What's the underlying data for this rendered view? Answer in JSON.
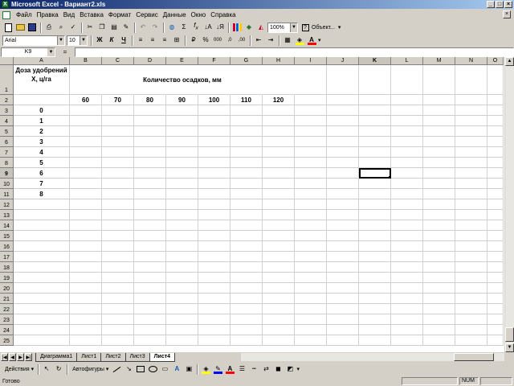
{
  "window": {
    "title": "Microsoft Excel - Вариант2.xls",
    "minimize": "_",
    "maximize": "□",
    "close": "×"
  },
  "menu": [
    "Файл",
    "Правка",
    "Вид",
    "Вставка",
    "Формат",
    "Сервис",
    "Данные",
    "Окно",
    "Справка"
  ],
  "toolbar_std": {
    "zoom": "100%",
    "objects_label": "Объект..."
  },
  "toolbar_fmt": {
    "font": "Arial",
    "size": "10",
    "bold": "Ж",
    "italic": "К",
    "underline": "Ч",
    "percent": "%",
    "thousands": "000"
  },
  "formula_bar": {
    "name_box": "K9",
    "equals": "=",
    "value": ""
  },
  "columns": [
    "A",
    "B",
    "C",
    "D",
    "E",
    "F",
    "G",
    "H",
    "I",
    "J",
    "K",
    "L",
    "M",
    "N",
    "O"
  ],
  "active_column": "K",
  "active_row": "9",
  "rows": [
    "1",
    "2",
    "3",
    "4",
    "5",
    "6",
    "7",
    "8",
    "9",
    "10",
    "11",
    "12",
    "13",
    "14",
    "15",
    "16",
    "17",
    "18",
    "19",
    "20",
    "21",
    "22",
    "23",
    "24",
    "25"
  ],
  "cells": {
    "a1": "Доза удобрений X, ц/га",
    "b1": "Количество осадков, мм",
    "row2": [
      "",
      "60",
      "70",
      "80",
      "90",
      "100",
      "110",
      "120",
      "",
      "",
      "",
      "",
      "",
      "",
      ""
    ],
    "col_a": [
      "0",
      "1",
      "2",
      "3",
      "4",
      "5",
      "6",
      "7",
      "8"
    ]
  },
  "sheet_tabs": [
    "Диаграмма1",
    "Лист1",
    "Лист2",
    "Лист3",
    "Лист4"
  ],
  "active_tab": "Лист4",
  "draw_toolbar": {
    "actions": "Действия",
    "autoshapes": "Автофигуры"
  },
  "status": {
    "text": "Готово",
    "num": "NUM"
  },
  "colors": {
    "title_gradient_start": "#0a246a",
    "title_gradient_end": "#a6caf0",
    "fill_color": "#ffff00",
    "font_color": "#ff0000",
    "line_color": "#0000ff"
  }
}
